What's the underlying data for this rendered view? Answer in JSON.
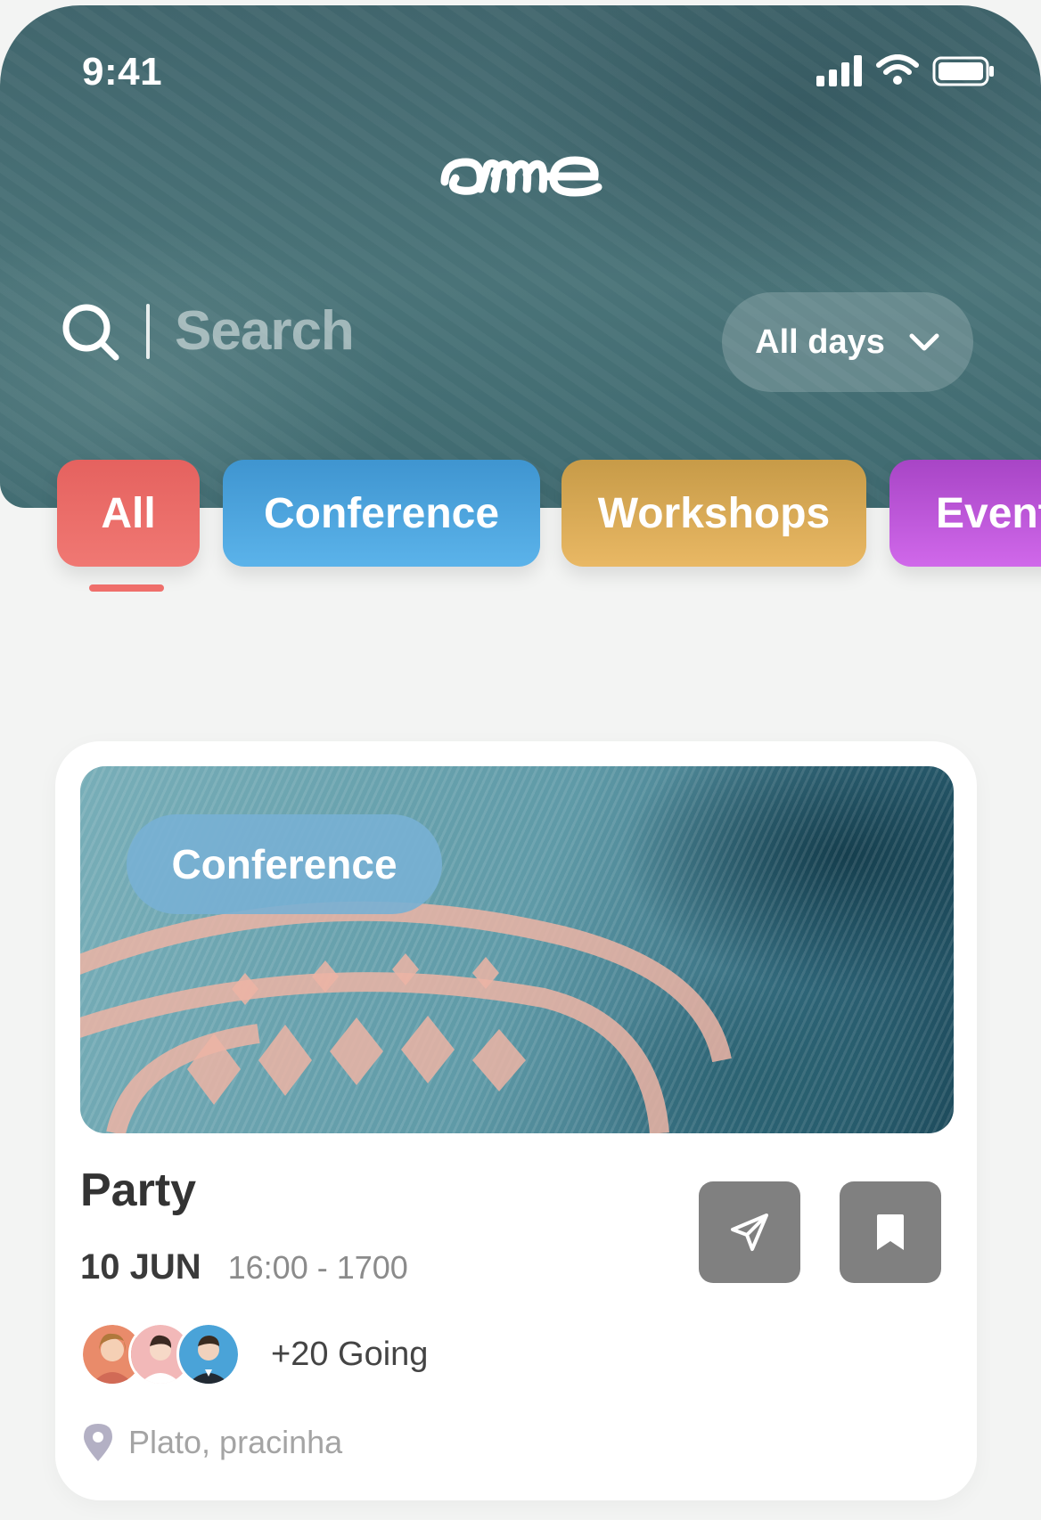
{
  "status_bar": {
    "time": "9:41"
  },
  "header": {
    "logo_text": "ame",
    "search": {
      "placeholder": "Search"
    },
    "day_filter": {
      "selected": "All days"
    }
  },
  "categories": [
    {
      "label": "All",
      "active": true,
      "color": "#ec6c68"
    },
    {
      "label": "Conference",
      "active": false,
      "color": "#4ea6df"
    },
    {
      "label": "Workshops",
      "active": false,
      "color": "#dcac56"
    },
    {
      "label": "Event",
      "active": false,
      "color": "#bd57d9"
    }
  ],
  "event_card": {
    "category_badge": "Conference",
    "title": "Party",
    "date": "10 JUN",
    "time": "16:00 - 1700",
    "going": "+20 Going",
    "location": "Plato, pracinha",
    "icons": {
      "share": "send-icon",
      "bookmark": "bookmark-icon",
      "location": "location-pin-icon"
    }
  }
}
